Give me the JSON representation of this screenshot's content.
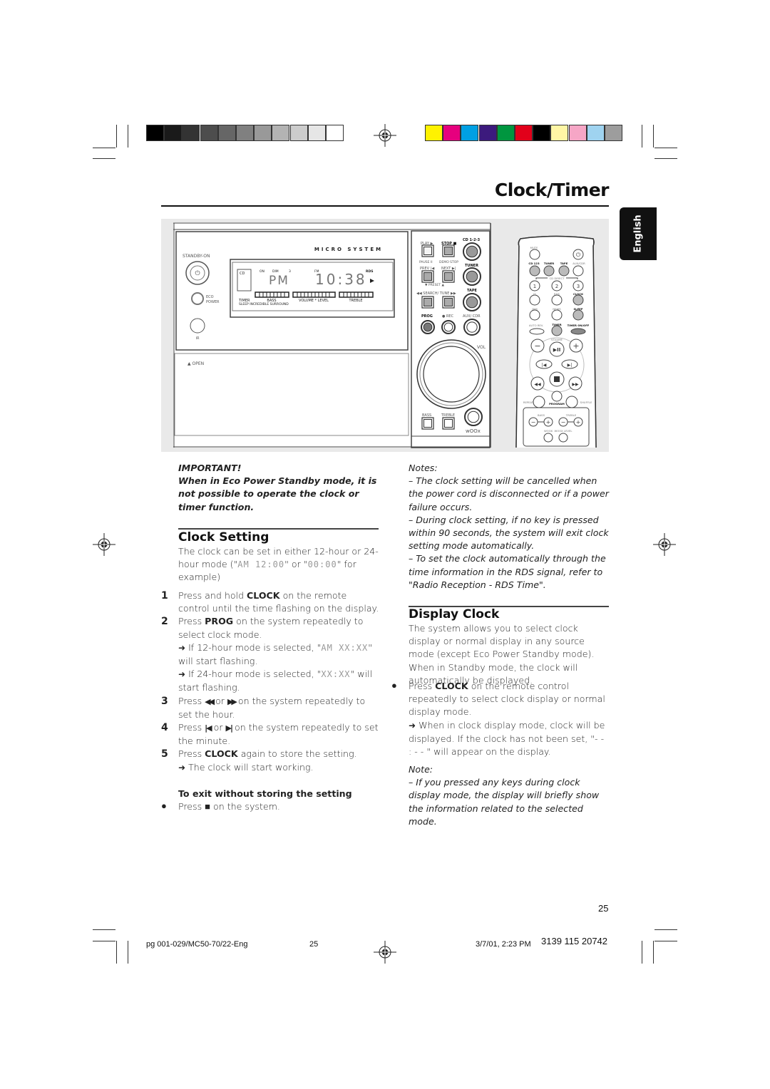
{
  "print_marks": {
    "gray_swatches": [
      "#000000",
      "#1a1a1a",
      "#333333",
      "#4d4d4d",
      "#666666",
      "#808080",
      "#999999",
      "#b3b3b3",
      "#cccccc",
      "#e6e6e6",
      "#ffffff"
    ],
    "color_swatches": [
      "#fff200",
      "#e6007e",
      "#00a0e3",
      "#3c1a7d",
      "#00963f",
      "#e2001a",
      "#000000",
      "#fff6a5",
      "#f6a6c6",
      "#9fd3f0",
      "#9d9d9d"
    ]
  },
  "header": {
    "title": "Clock/Timer",
    "language_tab": "English"
  },
  "device": {
    "brand_label": "MICRO SYSTEM",
    "standby_on": "STANDBY-ON",
    "eco": "ECO",
    "power": "POWER",
    "ir": "iR",
    "open": "▲ OPEN",
    "display": {
      "cd": "CD",
      "on": "ON",
      "dim": "DIM",
      "three": "3",
      "fm": "FM",
      "rds": "RDS",
      "pm": "PM",
      "time": "10:38",
      "timer": "TIMER",
      "sleep": "SLEEP INCREDIBLE SURROUND",
      "bass": "BASS",
      "volume": "VOLUME * LEVEL",
      "treble": "TREBLE"
    },
    "buttons": {
      "play": "PLAY ▶",
      "stop": "STOP ■",
      "cd123": "CD 1-2-3",
      "pause": "PAUSE II",
      "demo_stop": "DEMO STOP",
      "prev": "PREV |◀",
      "next": "NEXT ▶|",
      "tuner": "TUNER",
      "preset": "▼ PRESET ▲",
      "search_tune": "◀◀ SEARCH/ TUNE ▶▶",
      "tape": "TAPE",
      "prog": "PROG",
      "rec": "● REC",
      "aux_cdr": "AUX/ CDR",
      "vol": "VOL",
      "bass": "BASS",
      "treble": "TREBLE",
      "woox": "wOOx"
    }
  },
  "remote": {
    "mute": "MUTE",
    "cd123": "CD 123",
    "tuner": "TUNER",
    "tape": "TAPE",
    "aux_cdr": "AUX/CDR",
    "cd_direct": "CD DIRECT",
    "one": "1",
    "two": "2",
    "three": "3",
    "is": "IS",
    "rds": "RDS",
    "clock": "CLOCK",
    "dim": "DIM",
    "news": "NEWS",
    "sleep": "SLEEP",
    "auto_rev": "AUTO REV.",
    "timer": "TIMER",
    "timer_onoff": "TIMER ON/OFF",
    "volume": "VOLUME",
    "repeat": "REPEAT",
    "program": "PROGRAM",
    "shuffle": "SHUFFLE",
    "bass": "BASS",
    "treble": "TREBLE",
    "woox": "WOOX",
    "woox_level": "WOOX LEVEL"
  },
  "important": {
    "title": "IMPORTANT!",
    "text": "When in Eco Power Standby mode, it is not possible to operate the clock or timer function."
  },
  "clock_setting": {
    "heading": "Clock Setting",
    "intro": {
      "pre": "The clock can be set in either 12-hour or 24-hour mode (\"",
      "seg1": "AM  12:00",
      "mid": "\" or \"",
      "seg2": "00:00",
      "post": "\" for example)"
    },
    "step1": {
      "num": "1",
      "pre": "Press and hold ",
      "key": "CLOCK",
      "post": " on the remote control until the time flashing on the display."
    },
    "step2": {
      "num": "2",
      "pre": "Press ",
      "key": "PROG",
      "post": " on the system repeatedly to select clock mode.",
      "result1": {
        "pre": " If 12-hour mode is selected, \"",
        "seg": "AM XX:XX",
        "post": "\" will start flashing."
      },
      "result2": {
        "pre": " If 24-hour mode is selected, \"",
        "seg": "XX:XX",
        "post": "\" will start flashing."
      }
    },
    "step3": {
      "num": "3",
      "pre": "Press ",
      "or": " or ",
      "post": " on the system repeatedly to set the hour."
    },
    "step4": {
      "num": "4",
      "pre": "Press ",
      "or": " or ",
      "post": " on the system repeatedly to set the minute."
    },
    "step5": {
      "num": "5",
      "pre": "Press ",
      "key": "CLOCK",
      "post": " again to store the setting.",
      "result": " The clock will start working."
    },
    "exit_heading": "To exit without storing the setting",
    "exit_step": {
      "pre": "Press ",
      "post": " on the system."
    }
  },
  "notes": {
    "title": "Notes:",
    "items": [
      "–  The clock setting will be cancelled when the power cord is disconnected or if a power failure occurs.",
      "–  During clock setting, if no key is pressed within 90 seconds, the system will exit clock setting mode automatically.",
      "–  To set the clock automatically through the time information in the RDS signal, refer to \"Radio Reception - RDS Time\"."
    ]
  },
  "display_clock": {
    "heading": "Display Clock",
    "intro": "The system allows you to select clock display or normal display in any source mode (except Eco Power Standby mode).  When in Standby mode, the clock will automatically be displayed.",
    "step": {
      "pre": "Press ",
      "key": "CLOCK",
      "post": " on the remote control repeatedly to select clock display or normal display mode.",
      "result": " When in clock display mode, clock will be displayed.  If the clock has not been set, \"- - : - - \" will appear on the display."
    },
    "note_title": "Note:",
    "note": "–  If you pressed any keys during clock display mode, the display will briefly show the information related to the selected mode."
  },
  "page_number": "25",
  "footer": {
    "file": "pg 001-029/MC50-70/22-Eng",
    "page": "25",
    "date": "3/7/01, 2:23 PM",
    "code": "3139 115 20742"
  }
}
